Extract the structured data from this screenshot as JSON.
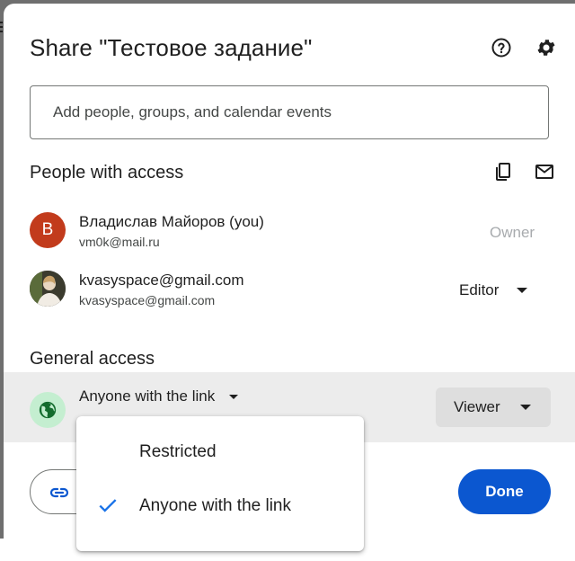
{
  "dialog": {
    "title": "Share \"Тестовое задание\"",
    "help_icon": "help-circle-icon",
    "settings_icon": "gear-icon"
  },
  "search": {
    "placeholder": "Add people, groups, and calendar events"
  },
  "people_section": {
    "title": "People with access",
    "copy_emails_icon": "copy-icon",
    "email_icon": "mail-icon",
    "people": [
      {
        "initial": "B",
        "avatar_color": "#c23b1c",
        "name": "Владислав Майоров (you)",
        "email": "vm0k@mail.ru",
        "role": "Owner"
      },
      {
        "initial": "",
        "avatar_color": "#4a4a3a",
        "name": "kvasyspace@gmail.com",
        "email": "kvasyspace@gmail.com",
        "role": "Editor"
      }
    ]
  },
  "general_access": {
    "title": "General access",
    "icon": "globe-icon",
    "selected": "Anyone with the link",
    "role": "Viewer"
  },
  "menu": {
    "options": [
      {
        "label": "Restricted",
        "checked": false
      },
      {
        "label": "Anyone with the link",
        "checked": true
      }
    ]
  },
  "footer": {
    "copy_link_icon": "link-icon",
    "done_label": "Done"
  },
  "colors": {
    "accent": "#0b57d0",
    "check": "#1a73e8",
    "general_band": "#ececec",
    "globe_bg": "#c4eed0",
    "globe_fg": "#146c2e"
  }
}
